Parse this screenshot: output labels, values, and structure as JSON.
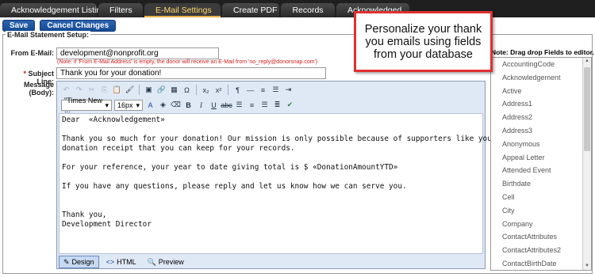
{
  "tabs": [
    "Acknowledgement Listing",
    "Filters",
    "E-Mail Settings",
    "Create PDF",
    "Records",
    "Acknowledged"
  ],
  "active_tab": "E-Mail Settings",
  "buttons": {
    "save": "Save",
    "cancel": "Cancel Changes"
  },
  "section_title": "E-Mail Statement Setup:",
  "from": {
    "label": "From E-Mail:",
    "value": "development@nonprofit.org",
    "note": "(Note: if 'From E-Mail Address' is empty, the donor will receive an E-Mail from 'no_reply@donorsnap.com')"
  },
  "subject": {
    "label": "Subject Line:",
    "required_mark": "*",
    "value": "Thank you for your donation!"
  },
  "message": {
    "label": "Message (Body):"
  },
  "toolbar": {
    "font_family": "\"Times New ...",
    "font_size": "16px"
  },
  "body_lines": [
    "Dear  «Acknowledgement»",
    "",
    "Thank you so much for your donation! Our mission is only possible because of supporters like you. Attached is your",
    "donation receipt that you can keep for your records.",
    "",
    "For your reference, your year to date giving total is $ «DonationAmountYTD»",
    "",
    "If you have any questions, please reply and let us know how we can serve you.",
    "",
    "",
    "Thank you,",
    "Development Director"
  ],
  "modes": {
    "design": "Design",
    "html": "HTML",
    "preview": "Preview"
  },
  "fields_note": "Note: Drag drop Fields to editor.",
  "fields": [
    "AccountingCode",
    "Acknowledgement",
    "Active",
    "Address1",
    "Address2",
    "Address3",
    "Anonymous",
    "Appeal Letter",
    "Attended Event",
    "Birthdate",
    "Cell",
    "City",
    "Company",
    "ContactAttributes",
    "ContactAttributes2",
    "ContactBirthDate"
  ],
  "callout": "Personalize your thank you emails using fields from your database",
  "colors": {
    "accent": "#1a4f98",
    "callout_border": "#e03030",
    "note": "#d01b1b"
  }
}
